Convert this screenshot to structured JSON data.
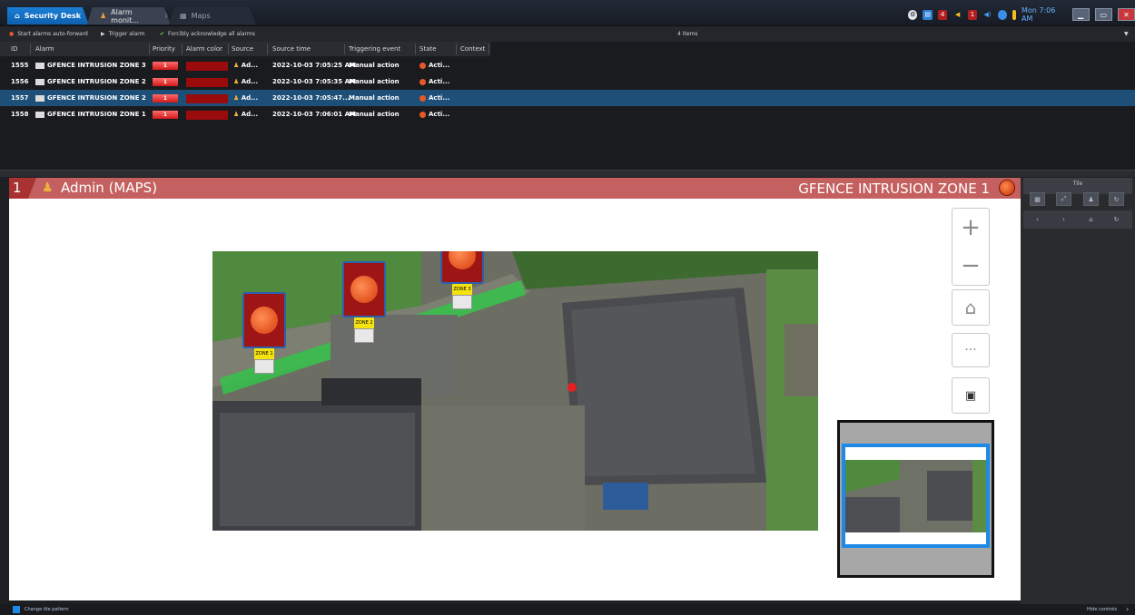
{
  "tabs": [
    {
      "label": "Security Desk",
      "icon": "home-icon"
    },
    {
      "label": "Alarm monit...",
      "icon": "alarm-monitor-icon"
    },
    {
      "label": "Maps",
      "icon": "map-icon"
    }
  ],
  "tray": {
    "clock": "Mon 7:06 AM",
    "badge_count": "4",
    "badge_count_2": "1"
  },
  "toolbar": {
    "start_forward": "Start alarms auto-forward",
    "trigger": "Trigger alarm",
    "acknowledge": "Forcibly acknowledge all alarms",
    "items_count": "4 items"
  },
  "alarm_table": {
    "columns": [
      "ID",
      "Alarm",
      "Priority",
      "Alarm color",
      "Source",
      "Source time",
      "Triggering event",
      "State",
      "Context"
    ],
    "rows": [
      {
        "id": "1555",
        "alarm": "GFENCE INTRUSION ZONE 3",
        "priority": "1",
        "source": "Ad...",
        "time": "2022-10-03 7:05:25 AM",
        "event": "Manual action",
        "state": "Acti..."
      },
      {
        "id": "1556",
        "alarm": "GFENCE INTRUSION ZONE 2",
        "priority": "1",
        "source": "Ad...",
        "time": "2022-10-03 7:05:35 AM",
        "event": "Manual action",
        "state": "Acti..."
      },
      {
        "id": "1557",
        "alarm": "GFENCE INTRUSION ZONE 2",
        "priority": "1",
        "source": "Ad...",
        "time": "2022-10-03 7:05:47...",
        "event": "Manual action",
        "state": "Acti..."
      },
      {
        "id": "1558",
        "alarm": "GFENCE INTRUSION ZONE 1",
        "priority": "1",
        "source": "Ad...",
        "time": "2022-10-03 7:06:01 AM",
        "event": "Manual action",
        "state": "Acti..."
      }
    ],
    "selected_index": 2
  },
  "tile": {
    "number": "1",
    "title": "Admin (MAPS)",
    "alarm_name": "GFENCE INTRUSION ZONE 1"
  },
  "map": {
    "zones": [
      {
        "label": "ZONE 1"
      },
      {
        "label": "ZONE 2"
      },
      {
        "label": "ZONE 3"
      }
    ],
    "controls": [
      "zoom-in",
      "zoom-out",
      "home",
      "more",
      "layers"
    ]
  },
  "right_panel": {
    "header": "Tile"
  },
  "status_bar": {
    "left": "Change tile pattern",
    "right": "Hide controls"
  },
  "colors": {
    "accent": "#1a7fd6",
    "tile_bar": "#c56060",
    "alarm_red": "#9a0b0b",
    "selected_row": "#1d4f78"
  }
}
